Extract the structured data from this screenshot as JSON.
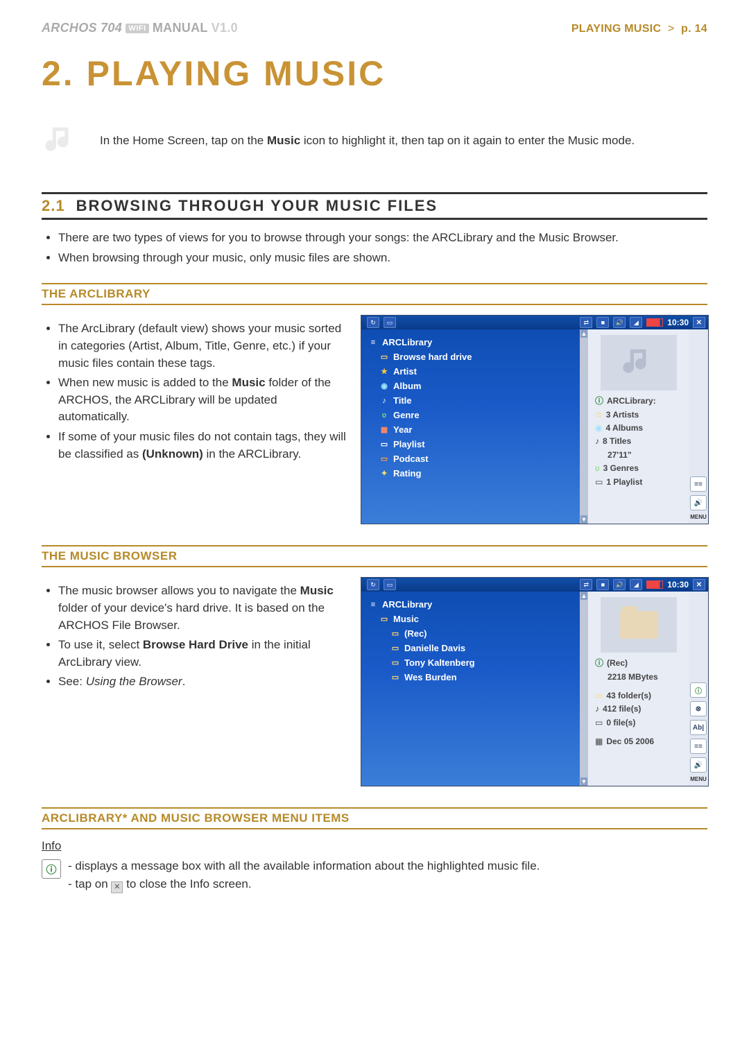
{
  "header": {
    "brand": "ARCHOS 704",
    "wifi": "WIFI",
    "manual": "MANUAL",
    "version": "V1.0",
    "right": "PLAYING MUSIC",
    "page": "p. 14",
    "sep": ">"
  },
  "title": "2. PLAYING MUSIC",
  "intro": {
    "a": "In the Home Screen, tap on the ",
    "b": "Music",
    "c": " icon to highlight it, then tap on it again to enter the Music mode."
  },
  "sec21": {
    "num": "2.1",
    "title": "BROWSING THROUGH YOUR MUSIC FILES"
  },
  "bullets21": [
    "There are two types of views for you to browse through your songs: the ARCLibrary and the Music Browser.",
    "When browsing through your music, only music files are shown."
  ],
  "arclib": {
    "heading": "THE ARCLIBRARY",
    "b1a": "The ArcLibrary (default view) shows your music sorted in categories (Artist, Album, Title, Genre, etc.) if your music files contain these tags.",
    "b2a": "When new music is added to the ",
    "b2b": "Music",
    "b2c": " folder of the ARCHOS, the ARCLibrary will be updated automatically.",
    "b3a": "If some of your music files do not contain tags, they will be classified as ",
    "b3b": "(Unknown)",
    "b3c": " in the ARCLibrary."
  },
  "shot1": {
    "clock": "10:30",
    "items": [
      "ARCLibrary",
      "Browse hard drive",
      "Artist",
      "Album",
      "Title",
      "Genre",
      "Year",
      "Playlist",
      "Podcast",
      "Rating"
    ],
    "right_title": "ARCLibrary:",
    "right_lines": [
      "3 Artists",
      "4 Albums",
      "8 Titles",
      "27'11\"",
      "3 Genres",
      "1 Playlist"
    ],
    "menu": "MENU"
  },
  "musicb": {
    "heading": "THE MUSIC BROWSER",
    "b1a": "The music browser allows you to navigate the ",
    "b1b": "Music",
    "b1c": " folder of your device's hard drive. It is based on the ARCHOS File Browser.",
    "b2a": "To use it, select ",
    "b2b": "Browse Hard Drive",
    "b2c": " in the initial ArcLibrary view.",
    "b3a": "See: ",
    "b3b": "Using the Browser",
    "b3c": "."
  },
  "shot2": {
    "clock": "10:30",
    "items": [
      "ARCLibrary",
      "Music",
      "(Rec)",
      "Danielle Davis",
      "Tony Kaltenberg",
      "Wes Burden"
    ],
    "right_title": "(Rec)",
    "right_size": "2218 MBytes",
    "right_lines": [
      "43 folder(s)",
      "412 file(s)",
      "0 file(s)"
    ],
    "right_date": "Dec 05 2006",
    "menu": "MENU"
  },
  "menuitems": {
    "heading": "ARCLIBRARY* AND MUSIC BROWSER MENU ITEMS"
  },
  "info": {
    "label": "Info",
    "line1": "displays a message box with all the available information about the highlighted music file.",
    "line2a": "tap on ",
    "line2b": " to close the Info screen.",
    "x": "✕"
  }
}
